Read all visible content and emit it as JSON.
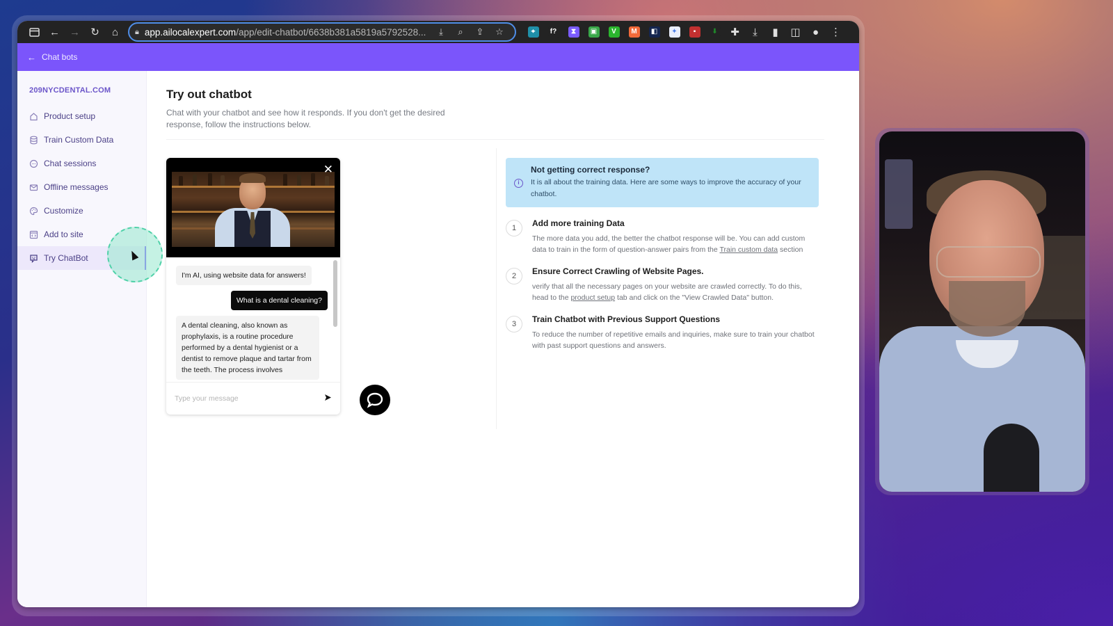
{
  "browser": {
    "url_host": "app.ailocalexpert.com",
    "url_path": "/app/edit-chatbot/6638b381a5819a5792528...",
    "toolbar_icons": [
      "sidebar-toggle-icon",
      "back-icon",
      "forward-icon",
      "reload-icon",
      "home-icon"
    ],
    "omnibox_icons": [
      "install-app-icon",
      "zoom-icon",
      "share-icon",
      "bookmark-star-icon"
    ],
    "extensions": [
      {
        "name": "extension-cursor-icon",
        "color": "#1f8fa8",
        "glyph": "⌖"
      },
      {
        "name": "extension-fx-icon",
        "color": "#232323",
        "glyph": "f?"
      },
      {
        "name": "extension-hourglass-icon",
        "color": "#7a5cff",
        "glyph": "⧗"
      },
      {
        "name": "extension-green-robot-icon",
        "color": "#3aa84a",
        "glyph": "▣"
      },
      {
        "name": "extension-v-icon",
        "color": "#2bb52e",
        "glyph": "V"
      },
      {
        "name": "extension-orange-circle-icon",
        "color": "#f26a3a",
        "glyph": "M"
      },
      {
        "name": "extension-navy-icon",
        "color": "#14254f",
        "glyph": "◧"
      },
      {
        "name": "extension-blue-sparkle-icon",
        "color": "#e9eefc",
        "glyph": "✦"
      },
      {
        "name": "extension-red-square-icon",
        "color": "#c23030",
        "glyph": "▪"
      },
      {
        "name": "extension-green-arrow-icon",
        "color": "#232323",
        "glyph": "⬇"
      }
    ],
    "right_icons": [
      "puzzle-extensions-icon",
      "download-icon",
      "side-panel-icon",
      "split-view-icon",
      "profile-icon",
      "more-menu-icon"
    ]
  },
  "appbar": {
    "back_label": "Chat bots"
  },
  "sidebar": {
    "brand": "209NYCDENTAL.COM",
    "items": [
      {
        "label": "Product setup",
        "icon": "home-icon",
        "active": false
      },
      {
        "label": "Train Custom Data",
        "icon": "database-icon",
        "active": false
      },
      {
        "label": "Chat sessions",
        "icon": "chat-bubble-icon",
        "active": false
      },
      {
        "label": "Offline messages",
        "icon": "mail-icon",
        "active": false
      },
      {
        "label": "Customize",
        "icon": "palette-icon",
        "active": false
      },
      {
        "label": "Add to site",
        "icon": "code-window-icon",
        "active": false
      },
      {
        "label": "Try ChatBot",
        "icon": "bot-face-icon",
        "active": true
      }
    ]
  },
  "main": {
    "title": "Try out chatbot",
    "subtitle": "Chat with your chatbot and see how it responds. If you don't get the desired response, follow the instructions below."
  },
  "chat": {
    "messages": [
      {
        "role": "bot",
        "text": "I'm AI, using website data for answers!"
      },
      {
        "role": "user",
        "text": "What is a dental cleaning?"
      },
      {
        "role": "bot",
        "text": "A dental cleaning, also known as prophylaxis, is a routine procedure performed by a dental hygienist or a dentist to remove plaque and tartar from the teeth. The process involves"
      }
    ],
    "input_placeholder": "Type your message",
    "input_value": ""
  },
  "tips": {
    "info_title": "Not getting correct response?",
    "info_text": "It is all about the training data. Here are some ways to improve the accuracy of your chatbot.",
    "steps": [
      {
        "num": "1",
        "title": "Add more training Data",
        "text_before": "The more data you add, the better the chatbot response will be. You can add custom data to train in the form of question-answer pairs from the ",
        "link": "Train custom data",
        "text_after": " section"
      },
      {
        "num": "2",
        "title": "Ensure Correct Crawling of Website Pages.",
        "text_before": "verify that all the necessary pages on your website are crawled correctly. To do this, head to the ",
        "link": "product setup",
        "text_after": " tab and click on the \"View Crawled Data\" button."
      },
      {
        "num": "3",
        "title": "Train Chatbot with Previous Support Questions",
        "text_before": "To reduce the number of repetitive emails and inquiries, make sure to train your chatbot with past support questions and answers.",
        "link": "",
        "text_after": ""
      }
    ]
  },
  "colors": {
    "accent": "#7b55fb",
    "info_bg": "#bfe4f8",
    "toolbar_bg": "#232323"
  }
}
